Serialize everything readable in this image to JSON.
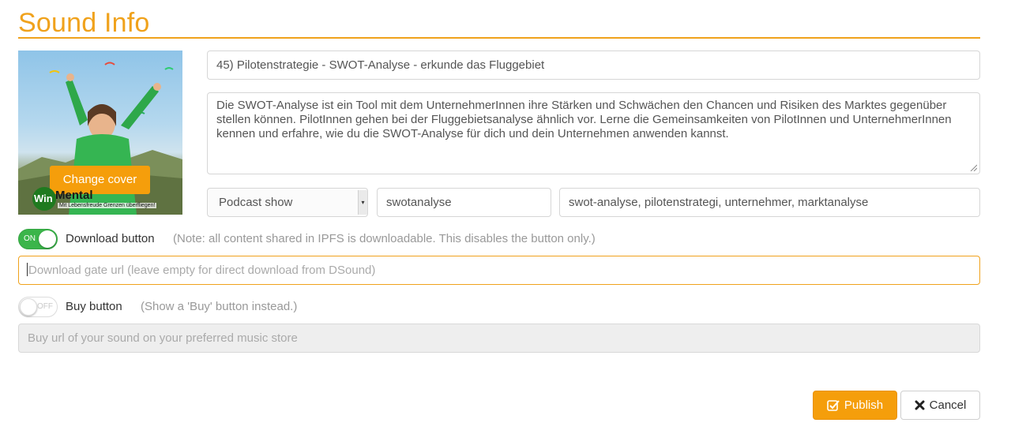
{
  "header": {
    "title": "Sound Info"
  },
  "cover": {
    "change_label": "Change cover",
    "brand_win": "Win",
    "brand_mental": "Mental",
    "brand_sub": "Mit Lebensfreude Grenzen überfliegen!"
  },
  "form": {
    "title_value": "45) Pilotenstrategie - SWOT-Analyse - erkunde das Fluggebiet",
    "description_value": "Die SWOT-Analyse ist ein Tool mit dem UnternehmerInnen ihre Stärken und Schwächen den Chancen und Risiken des Marktes gegenüber stellen können. PilotInnen gehen bei der Fluggebietsanalyse ähnlich vor. Lerne die Gemeinsamkeiten von PilotInnen und UnternehmerInnen kennen und erfahre, wie du die SWOT-Analyse für dich und dein Unternehmen anwenden kannst.",
    "category_selected": "Podcast show",
    "main_tag": "swotanalyse",
    "tags": "swot-analyse, pilotenstrategi, unternehmer, marktanalyse"
  },
  "download": {
    "toggle_state": "ON",
    "label": "Download button",
    "note": "(Note: all content shared in IPFS is downloadable. This disables the button only.)",
    "gate_placeholder": "Download gate url (leave empty for direct download from DSound)"
  },
  "buy": {
    "toggle_state": "OFF",
    "label": "Buy button",
    "note": "(Show a 'Buy' button instead.)",
    "url_placeholder": "Buy url of your sound on your preferred music store"
  },
  "actions": {
    "publish_label": "Publish",
    "cancel_label": "Cancel"
  },
  "colors": {
    "accent": "#f0a21c",
    "publish_bg": "#f59e0b",
    "toggle_on": "#3bb54a"
  },
  "icons": {
    "publish": "check-square-icon",
    "cancel": "close-icon",
    "select": "dropdown-arrow-icon"
  }
}
